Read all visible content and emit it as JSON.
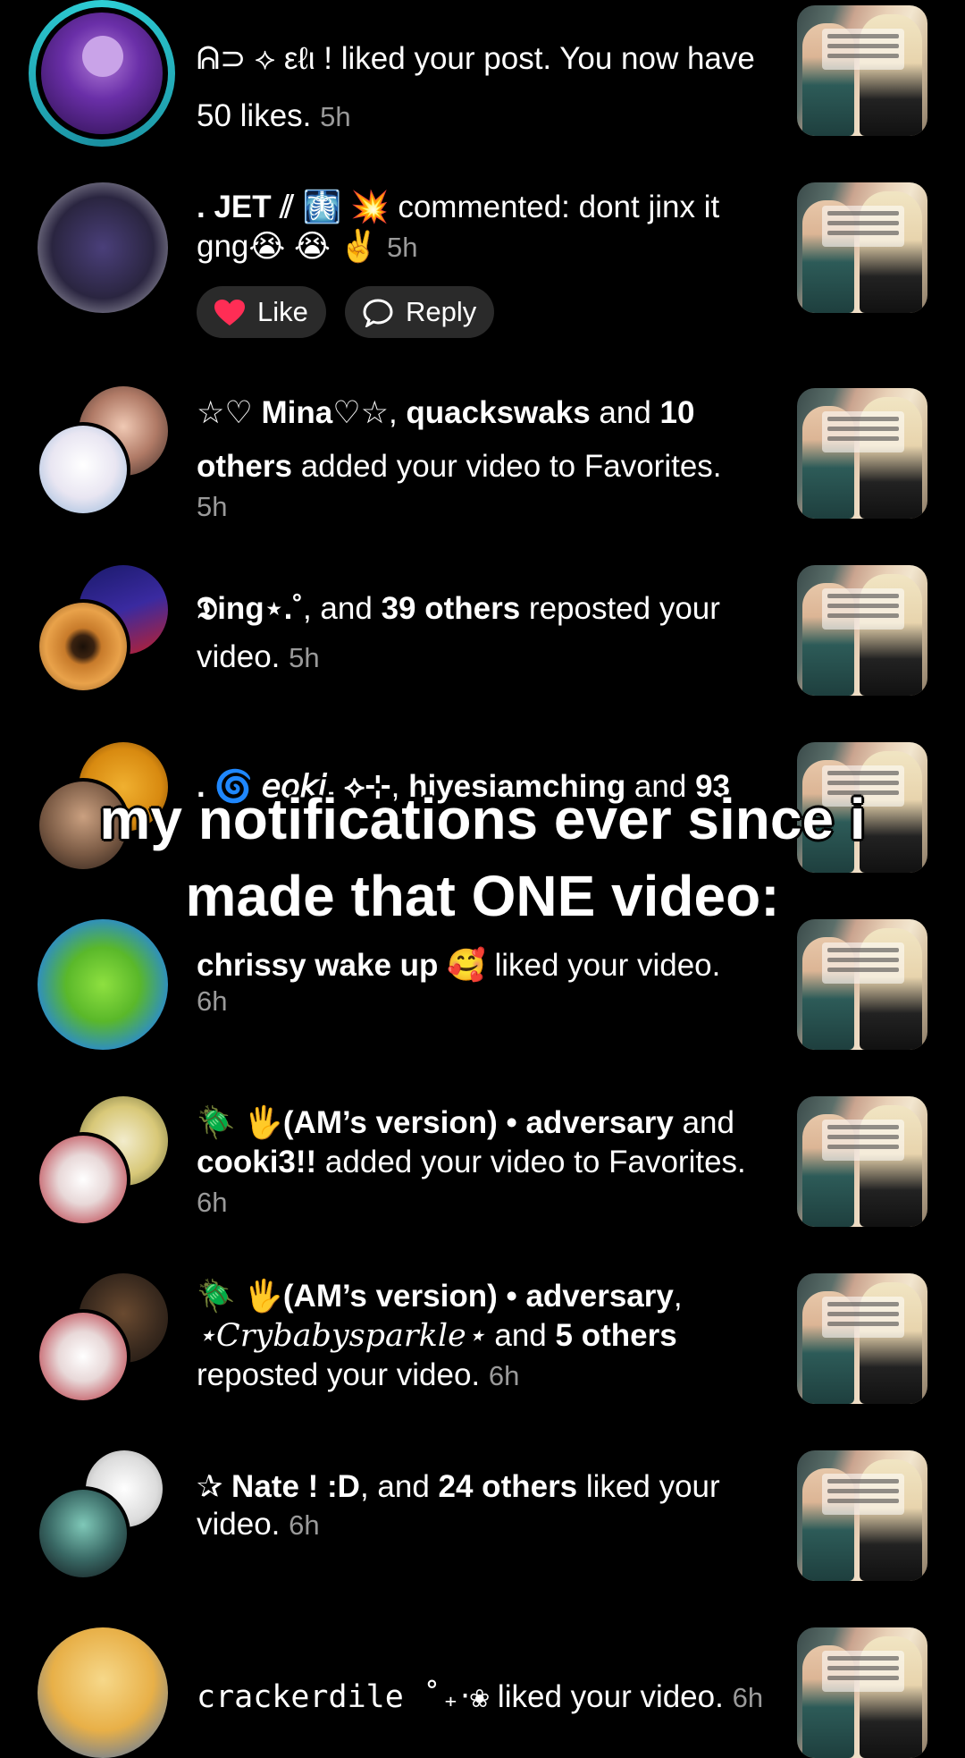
{
  "overlay": {
    "line1": "my notifications ever since i",
    "line2": "made that ONE video:"
  },
  "notifications": [
    {
      "name": "ᕱ⊃ ⟡ εℓι !",
      "text": " liked your post. You now have 50 likes.",
      "time": "5h"
    },
    {
      "name": ". JET ⫽ 🩻 💥",
      "text": " commented: dont jinx it gng😭 😭 ✌️",
      "time": "5h",
      "actions": {
        "like": "Like",
        "reply": "Reply"
      }
    },
    {
      "name1": "☆♡ Mina♡☆",
      "sep1": ", ",
      "name2": "quackswaks",
      "sep2": " and ",
      "name3": "10 others",
      "text": " added your video to Favorites.",
      "time": "5h"
    },
    {
      "name1": "𝕯ing⋆.˚",
      "sep1": ",  and ",
      "name2": "39 others",
      "text": " reposted your video.",
      "time": "5h"
    },
    {
      "name1": ". 🌀 𝘦𝘰𝘬𝘪. ⟡⊹",
      "sep1": ", ",
      "name2": "hiyesiamching",
      "sep2": " and ",
      "name3": "93"
    },
    {
      "name": "chrissy wake up 🥰",
      "text": " liked your video.",
      "time": "6h"
    },
    {
      "name1": "🪲 🖐(AM’s version) • adversary",
      "sep1": " and ",
      "name2": "cooki3!!",
      "text": " added your video to Favorites.",
      "time": "6h"
    },
    {
      "name1": "🪲 🖐(AM’s version) • adversary",
      "sep1": ", ",
      "name2": "⋆𝐶𝑟𝑦𝑏𝑎𝑏𝑦𝑠𝑝𝑎𝑟𝑘𝑙𝑒⋆",
      "sep2": " and ",
      "name3": "5 others",
      "text": " reposted your video.",
      "time": "6h"
    },
    {
      "name1": "✰ Nate ! :D",
      "sep1": ",  and ",
      "name2": "24 others",
      "text": " liked your video.",
      "time": "6h"
    },
    {
      "name": "crackerdile ˚₊‧❀",
      "text": " liked your video.",
      "time": "6h"
    }
  ]
}
